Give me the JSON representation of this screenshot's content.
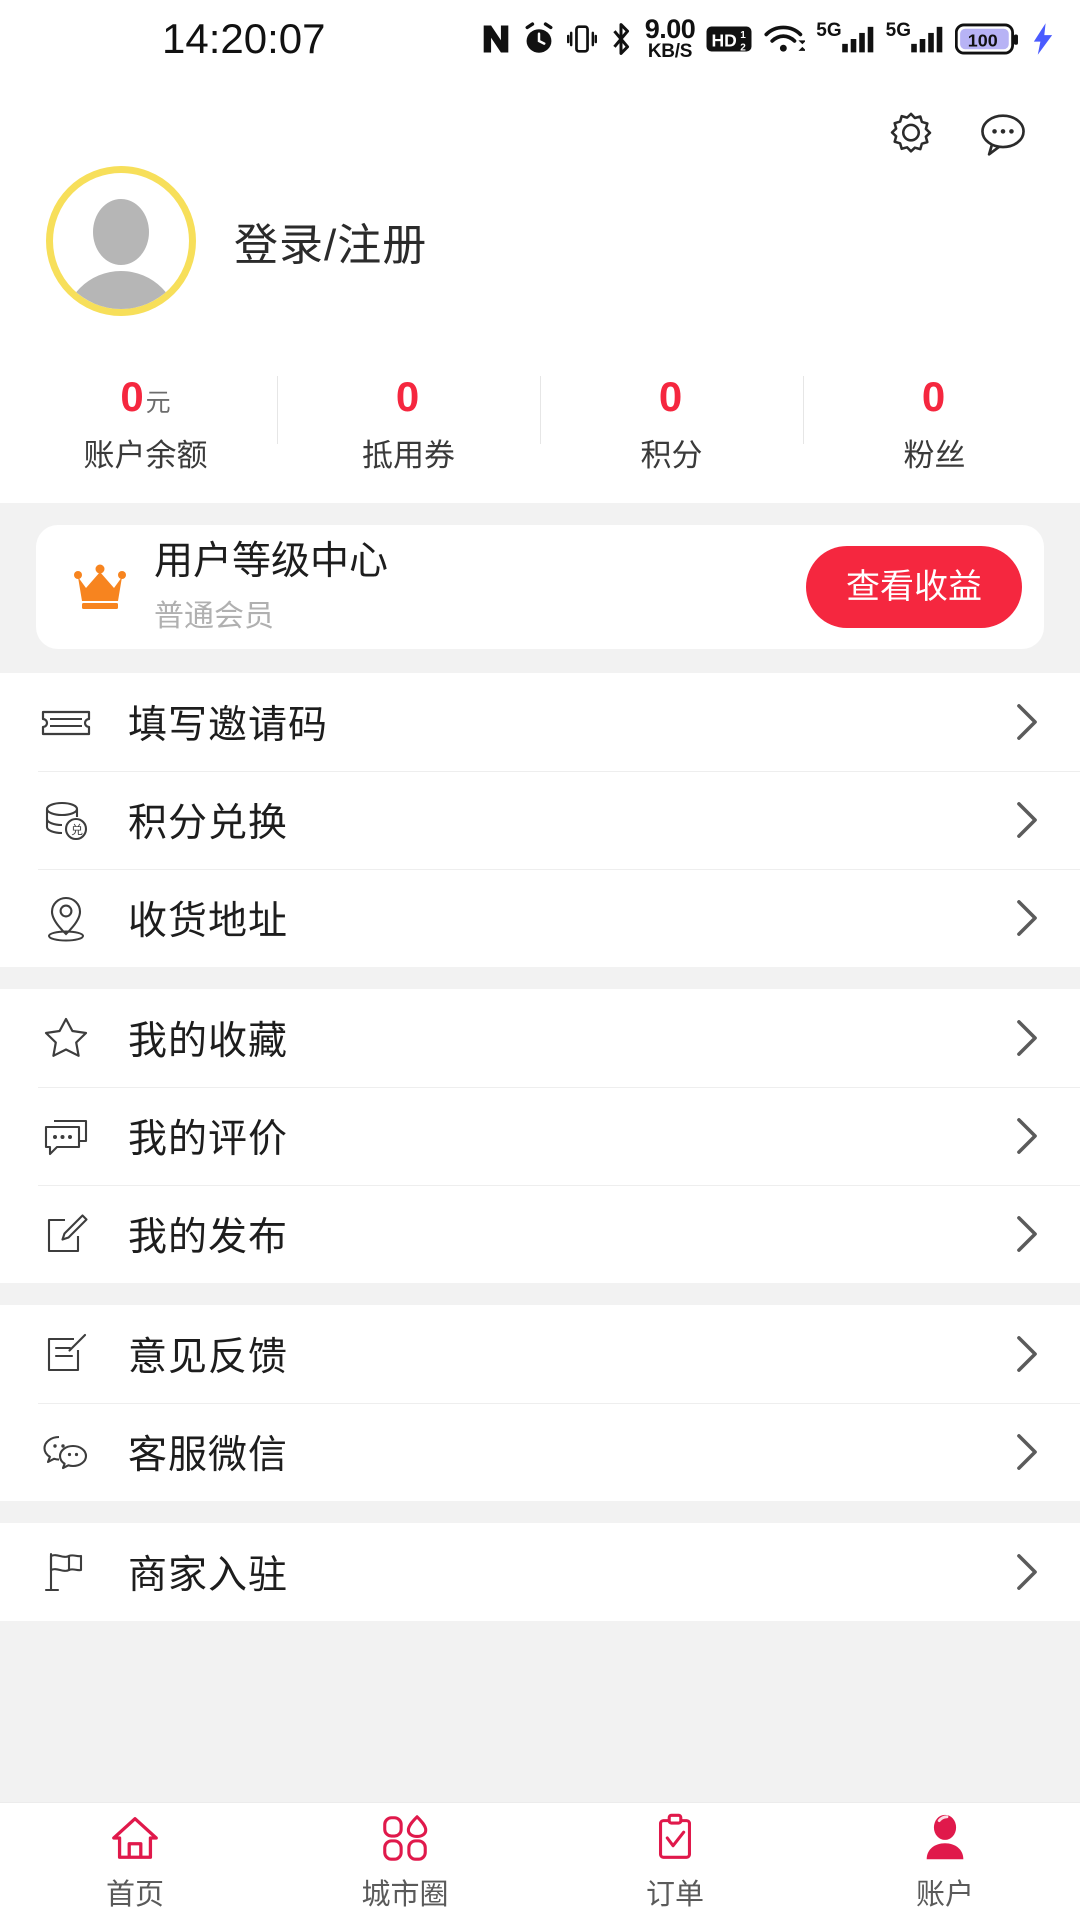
{
  "statusbar": {
    "time": "14:20:07",
    "net_speed_value": "9.00",
    "net_speed_unit": "KB/S",
    "battery": "100",
    "signal_label_1": "5G",
    "signal_label_2": "5G",
    "hd_label": "HD",
    "icons": [
      "nfc-icon",
      "alarm-clock-icon",
      "vibrate-icon",
      "bluetooth-icon",
      "network-speed-icon",
      "hd-volte-icon",
      "wifi-icon",
      "signal-5g-icon",
      "signal-5g-icon",
      "battery-icon",
      "charging-bolt-icon"
    ]
  },
  "header": {
    "settings_icon": "gear-icon",
    "message_icon": "chat-bubble-icon",
    "login_label": "登录/注册",
    "avatar_ring_color": "#f7df5a"
  },
  "stats": [
    {
      "value": "0",
      "unit": "元",
      "label": "账户余额"
    },
    {
      "value": "0",
      "unit": "",
      "label": "抵用券"
    },
    {
      "value": "0",
      "unit": "",
      "label": "积分"
    },
    {
      "value": "0",
      "unit": "",
      "label": "粉丝"
    }
  ],
  "vip": {
    "icon": "crown-icon",
    "title": "用户等级中心",
    "subtitle": "普通会员",
    "button_label": "查看收益",
    "button_color": "#f5273f"
  },
  "menu_groups": [
    {
      "items": [
        {
          "icon": "ticket-icon",
          "label": "填写邀请码"
        },
        {
          "icon": "coins-icon",
          "label": "积分兑换"
        },
        {
          "icon": "location-pin-icon",
          "label": "收货地址"
        }
      ]
    },
    {
      "items": [
        {
          "icon": "star-icon",
          "label": "我的收藏"
        },
        {
          "icon": "comment-icon",
          "label": "我的评价"
        },
        {
          "icon": "edit-square-icon",
          "label": "我的发布"
        }
      ]
    },
    {
      "items": [
        {
          "icon": "feedback-icon",
          "label": "意见反馈"
        },
        {
          "icon": "wechat-icon",
          "label": "客服微信"
        }
      ]
    },
    {
      "items": [
        {
          "icon": "flag-icon",
          "label": "商家入驻"
        }
      ]
    }
  ],
  "tabbar": {
    "active_color": "#e0194b",
    "inactive_color": "#e0194b",
    "label_color": "#5a5a5a",
    "items": [
      {
        "icon": "home-icon",
        "label": "首页",
        "active": false
      },
      {
        "icon": "city-circle-icon",
        "label": "城市圈",
        "active": false
      },
      {
        "icon": "clipboard-icon",
        "label": "订单",
        "active": false
      },
      {
        "icon": "account-icon",
        "label": "账户",
        "active": true
      }
    ]
  },
  "icon_glyphs": {
    "chevron_right": "›"
  }
}
